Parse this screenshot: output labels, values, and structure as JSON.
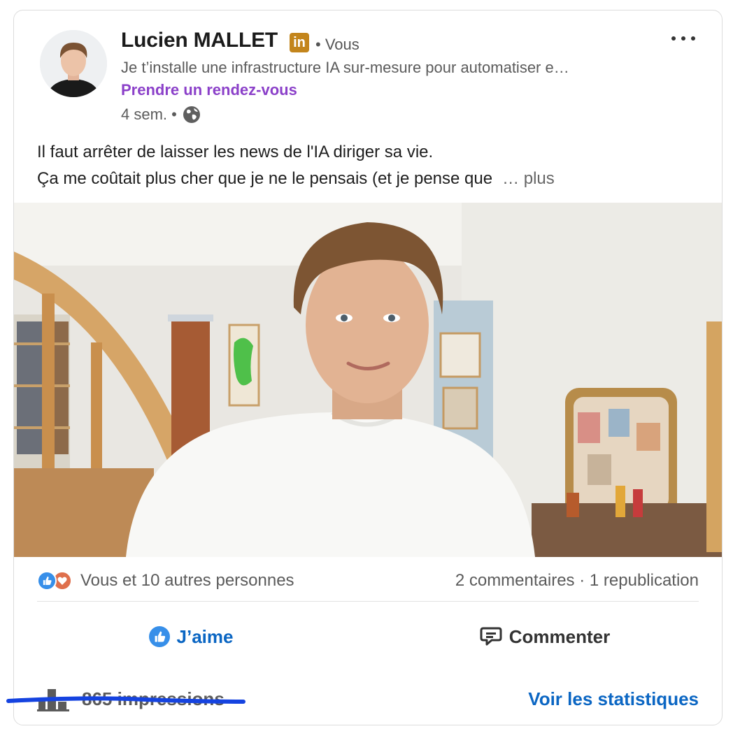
{
  "post": {
    "author_name": "Lucien MALLET",
    "linkedin_badge": "in",
    "relation": "• Vous",
    "headline": "Je t’installe une infrastructure IA sur-mesure pour automatiser e…",
    "cta_label": "Prendre un rendez-vous",
    "time_ago": "4 sem. •",
    "visibility_icon": "globe-icon",
    "text_line_1": "Il faut arrêter de laisser les news de l'IA diriger sa vie.",
    "text_line_2": "Ça me coûtait plus cher que je ne le pensais (et je pense que",
    "more_label": "… plus"
  },
  "social": {
    "reactions_text": "Vous et 10 autres personnes",
    "reaction_icons": [
      "like-icon",
      "love-icon"
    ],
    "comments_reposts": "2 commentaires · 1 republication"
  },
  "actions": {
    "like_label": "J’aime",
    "comment_label": "Commenter"
  },
  "footer": {
    "impressions": "865 impressions",
    "stats_link": "Voir les statistiques"
  },
  "colors": {
    "accent_blue": "#0b66c3",
    "cta_purple": "#8b40c9",
    "badge_gold": "#c3851c",
    "underline_blue": "#1543e0"
  }
}
